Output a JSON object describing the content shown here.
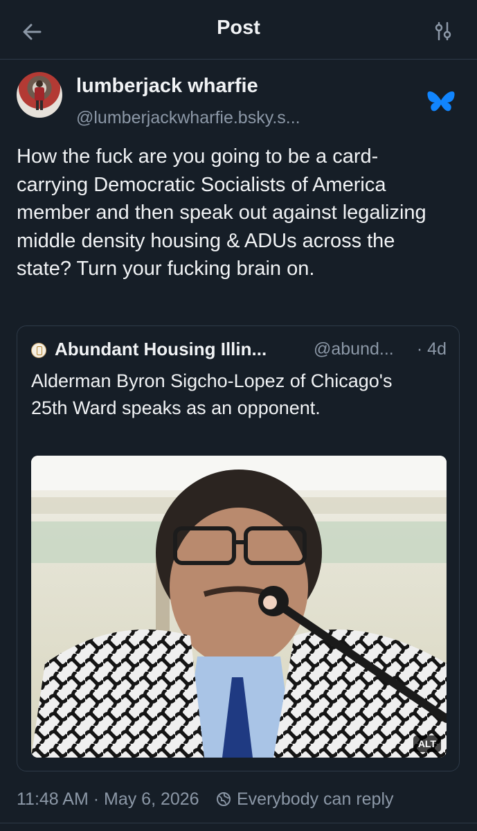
{
  "header": {
    "title": "Post",
    "back_icon": "arrow-left-icon",
    "settings_icon": "sliders-icon"
  },
  "post": {
    "author_name": "lumberjack wharfie",
    "author_handle": "@lumberjackwharfie.bsky.s...",
    "platform_icon": "bluesky-butterfly-icon",
    "text": "How the fuck are you going to be a card-carrying Democratic Socialists of America member and then speak out against legalizing middle density housing & ADUs across the state? Turn your fucking brain on.",
    "timestamp": "11:48 AM · May 6, 2026",
    "reply_setting": "Everybody can reply"
  },
  "quote": {
    "author_name": "Abundant Housing Illin...",
    "author_handle": "@abund...",
    "time": "· 4d",
    "text": "Alderman Byron Sigcho-Lopez of Chicago's 25th Ward speaks as an opponent.",
    "alt_badge": "ALT"
  },
  "colors": {
    "background": "#161e27",
    "text_primary": "#f1f3f5",
    "text_secondary": "#8c98a7",
    "divider": "#2e3a48",
    "bluesky_accent": "#1185fe"
  }
}
